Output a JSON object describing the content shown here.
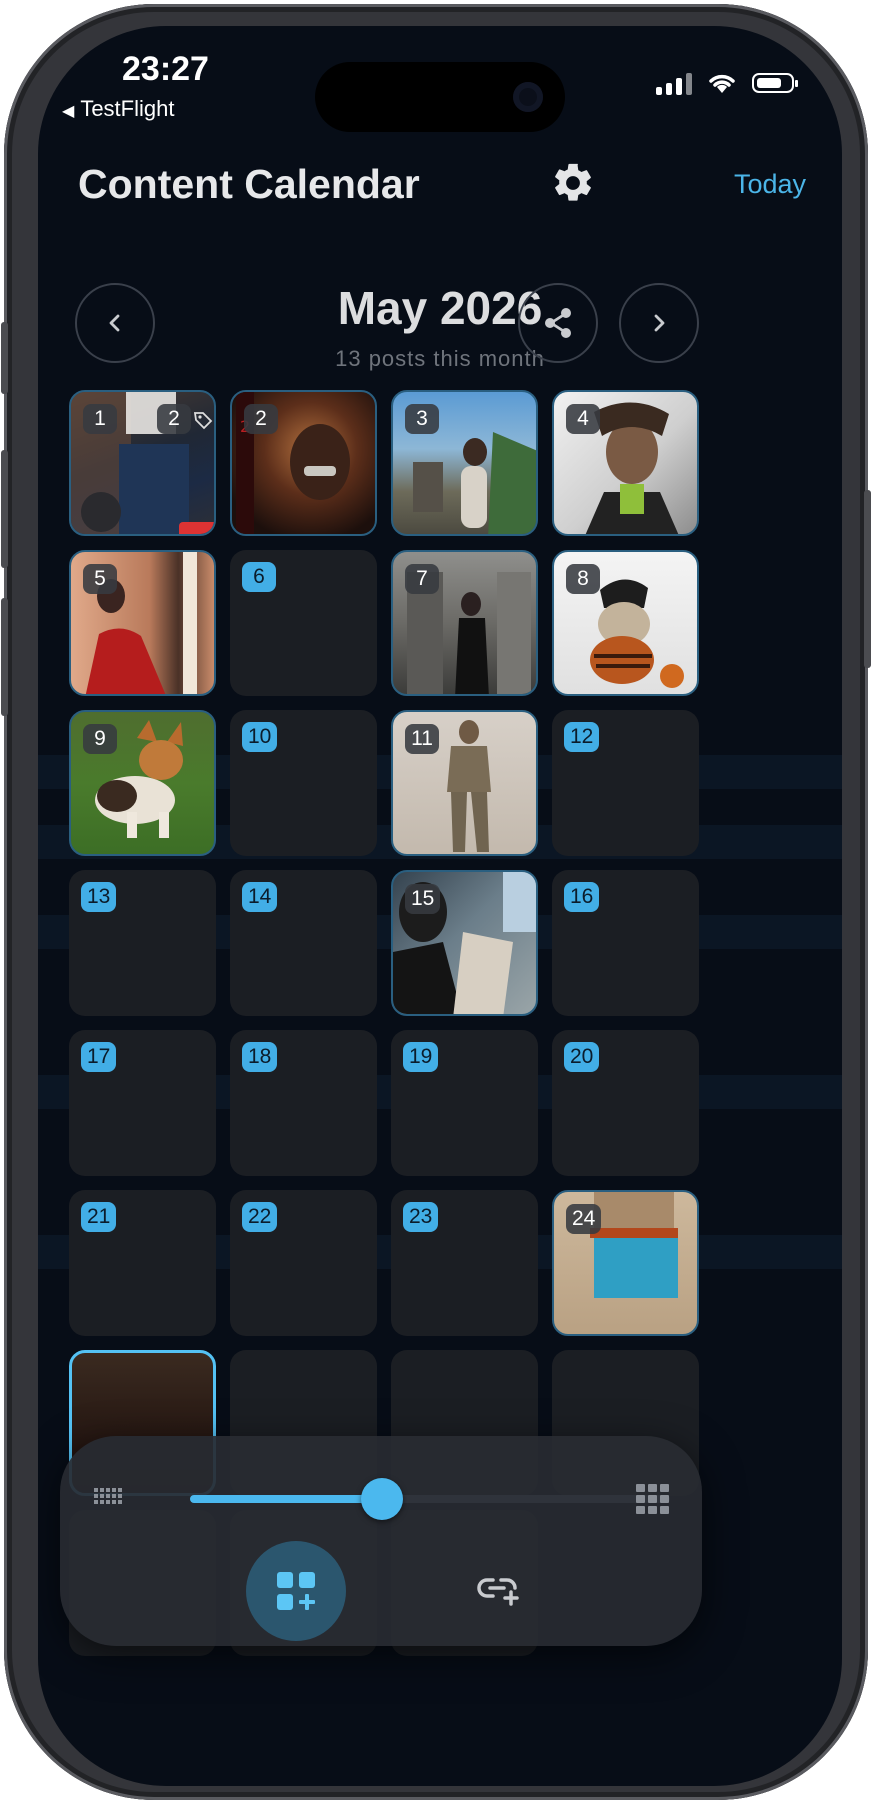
{
  "status": {
    "time": "23:27",
    "back_app": "TestFlight"
  },
  "header": {
    "title": "Content Calendar",
    "today_label": "Today"
  },
  "month": {
    "title": "May 2026",
    "subtitle": "13 posts this month"
  },
  "days": [
    {
      "day": "1",
      "count": "2"
    },
    {
      "day": "2"
    },
    {
      "day": "3"
    },
    {
      "day": "4"
    },
    {
      "day": "5"
    },
    {
      "day": "6"
    },
    {
      "day": "7"
    },
    {
      "day": "8"
    },
    {
      "day": "9"
    },
    {
      "day": "10"
    },
    {
      "day": "11"
    },
    {
      "day": "12"
    },
    {
      "day": "13"
    },
    {
      "day": "14"
    },
    {
      "day": "15"
    },
    {
      "day": "16"
    },
    {
      "day": "17"
    },
    {
      "day": "18"
    },
    {
      "day": "19"
    },
    {
      "day": "20"
    },
    {
      "day": "21"
    },
    {
      "day": "22"
    },
    {
      "day": "23"
    },
    {
      "day": "24"
    }
  ],
  "grid_size_slider": {
    "value": 0.4
  },
  "colors": {
    "accent": "#4bb5e8",
    "background": "#070d17",
    "tile": "#1b1e23"
  },
  "icons": [
    "gear-icon",
    "chevron-left-icon",
    "chevron-right-icon",
    "share-icon",
    "small-grid-icon",
    "large-grid-icon",
    "add-post-icon",
    "add-link-icon"
  ]
}
